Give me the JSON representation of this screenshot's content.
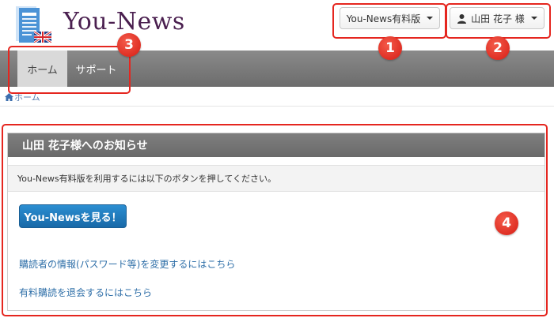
{
  "header": {
    "title": "You-News",
    "plan_button": "You-News有料版",
    "user_button": "山田 花子 様"
  },
  "nav": {
    "home": "ホーム",
    "support": "サポート"
  },
  "breadcrumb": {
    "home": "ホーム"
  },
  "panel": {
    "title": "山田 花子様へのお知らせ",
    "notice": "You-News有料版を利用するには以下のボタンを押してください。",
    "primary_button": "You-Newsを見る！",
    "link_change_info": "購読者の情報(パスワード等)を変更するにはこちら",
    "link_unsubscribe": "有料購読を退会するにはこちら"
  },
  "annotations": {
    "n1": "1",
    "n2": "2",
    "n3": "3",
    "n4": "4"
  },
  "colors": {
    "annotation": "#e5261f",
    "nav_bg": "#777777",
    "primary": "#1d75b9",
    "link": "#2f6fa8",
    "logo_text": "#4a1f4f"
  },
  "icons": {
    "logo": "newspaper-icon",
    "flag": "uk-flag-icon",
    "user": "user-icon",
    "home": "home-icon"
  }
}
